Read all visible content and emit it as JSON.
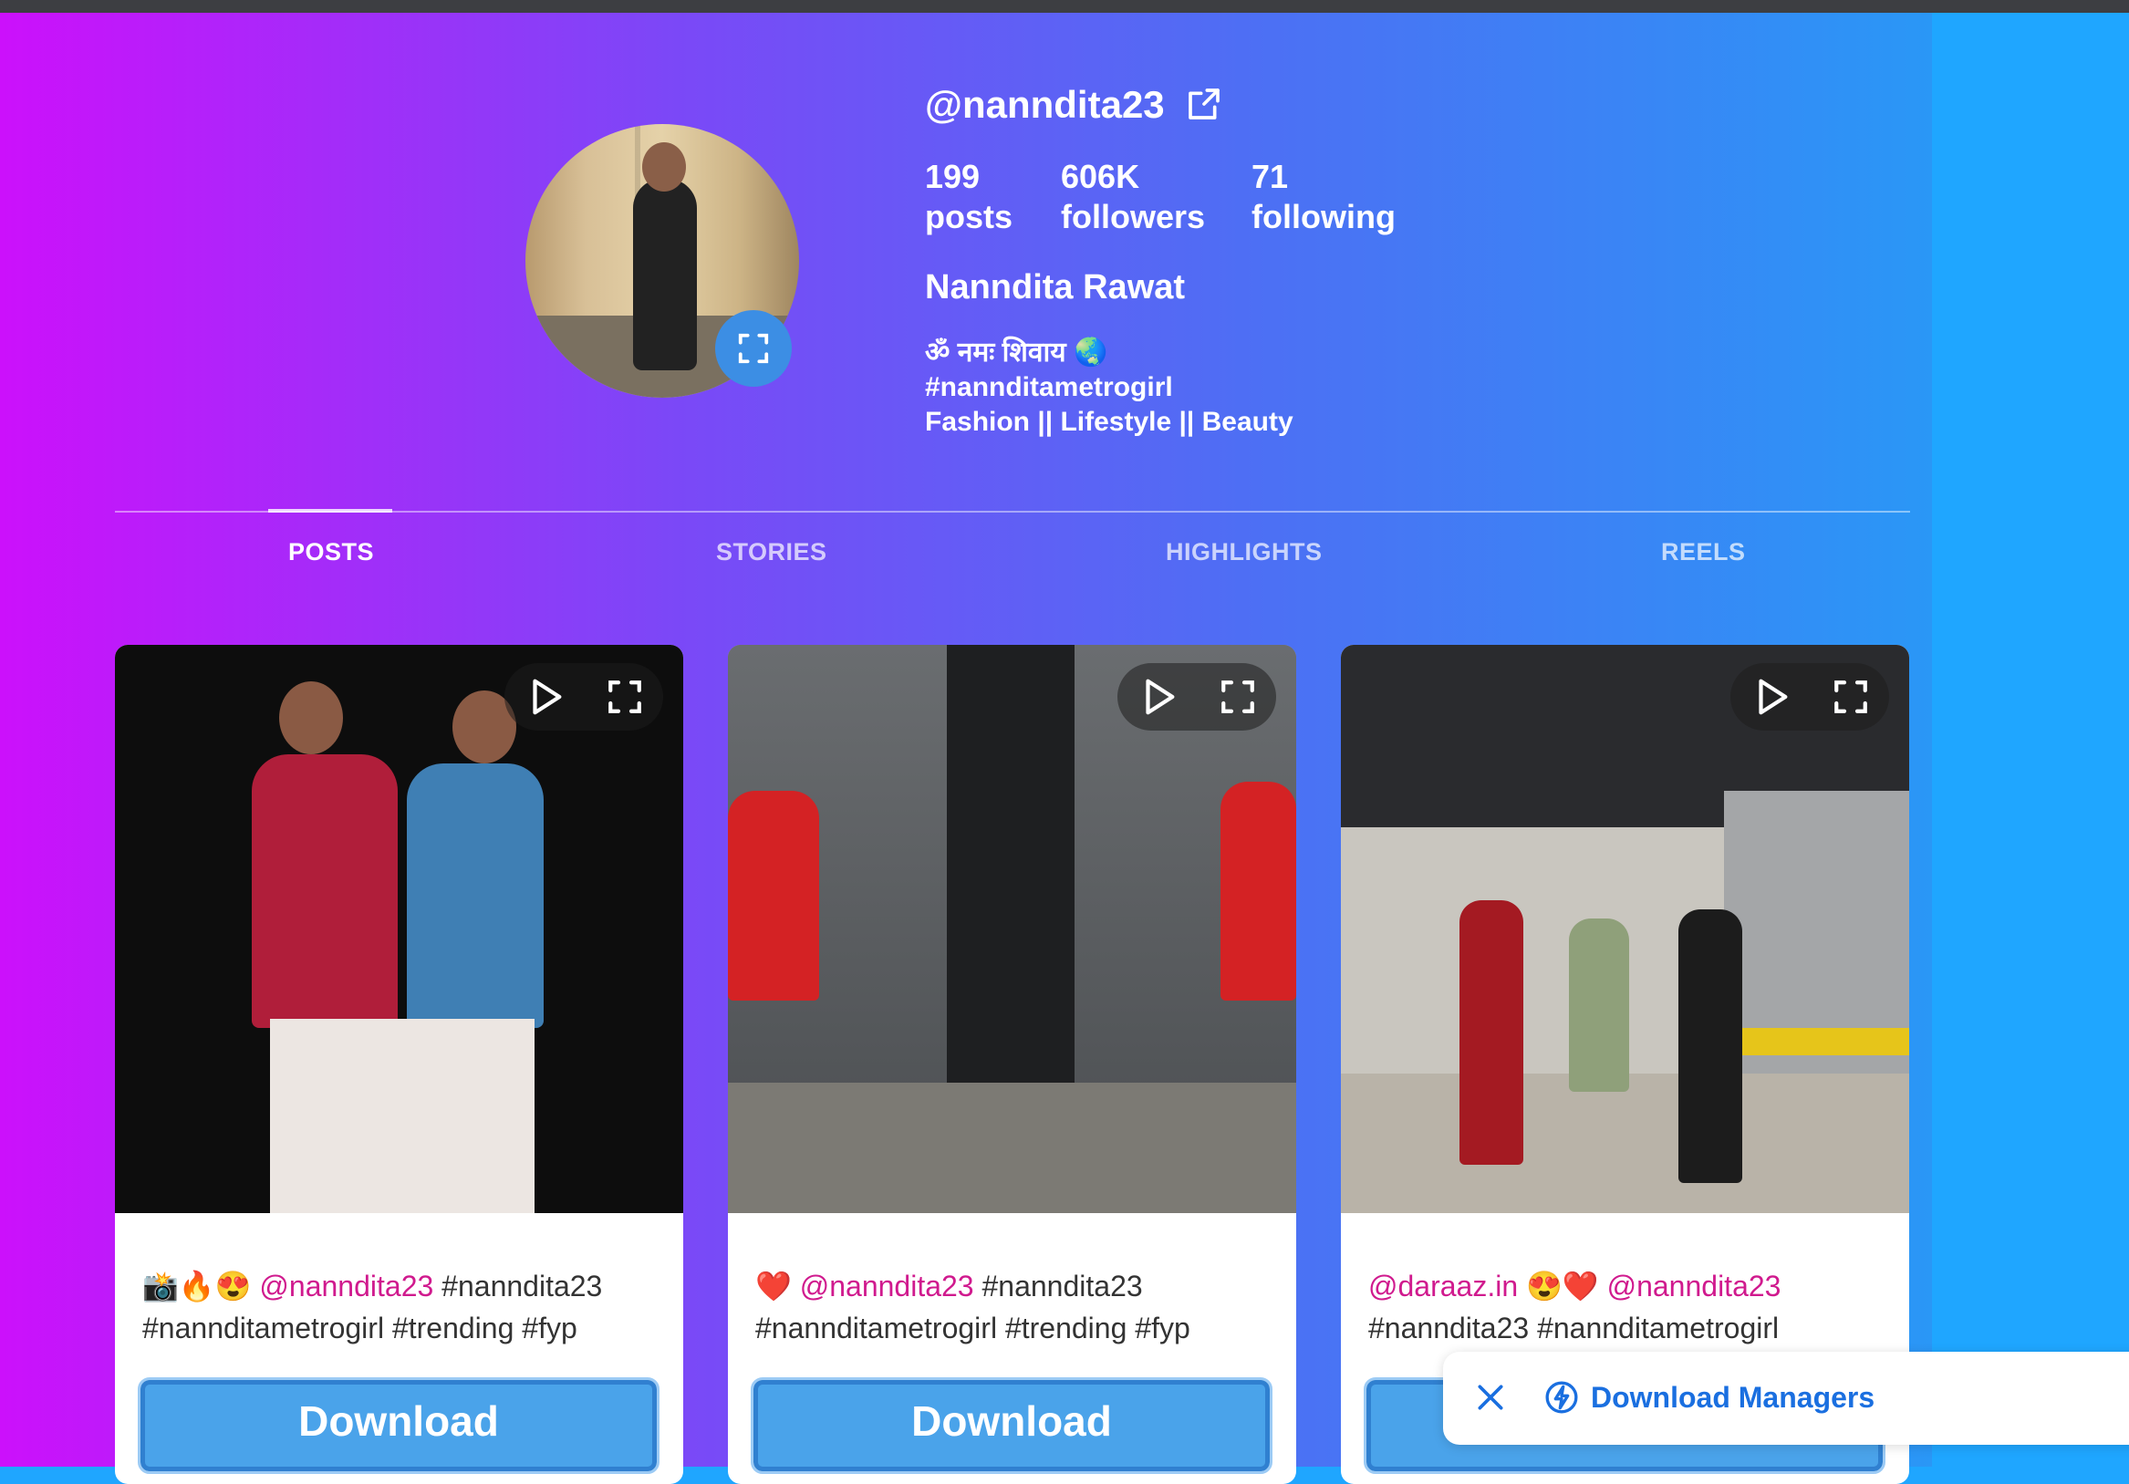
{
  "profile": {
    "username": "@nanndita23",
    "stats": {
      "posts_value": "199",
      "posts_label": "posts",
      "followers_value": "606K",
      "followers_label": "followers",
      "following_value": "71",
      "following_label": "following"
    },
    "full_name": "Nanndita Rawat",
    "bio_line1": "ॐ नमः शिवाय 🌏",
    "bio_line2": "#nannditametrogirl",
    "bio_line3": "Fashion || Lifestyle || Beauty"
  },
  "tabs": [
    "POSTS",
    "STORIES",
    "HIGHLIGHTS",
    "REELS"
  ],
  "active_tab": "POSTS",
  "posts": [
    {
      "caption_prefix": "📸🔥😍 ",
      "mention": "@nanndita23",
      "caption_rest": " #nanndita23 #nannditametrogirl #trending #fyp",
      "download_label": "Download"
    },
    {
      "caption_prefix": "❤️ ",
      "mention": "@nanndita23",
      "caption_rest": " #nanndita23 #nannditametrogirl #trending #fyp",
      "download_label": "Download"
    },
    {
      "caption_prefix": "",
      "mention": "@daraaz.in",
      "caption_mid": " 😍❤️ ",
      "mention2": "@nanndita23",
      "caption_rest": " #nanndita23 #nannditametrogirl",
      "download_label": "Download"
    }
  ],
  "popup": {
    "label": "Download Managers"
  },
  "colors": {
    "gradient_start": "#cc10fb",
    "gradient_end": "#2a97f6",
    "mention": "#d01a8e",
    "button": "#4aa3ea",
    "popup_text": "#1a6fe0"
  },
  "icons": [
    "external-link-icon",
    "expand-icon",
    "play-icon",
    "fullscreen-icon",
    "close-icon",
    "download-manager-icon"
  ]
}
